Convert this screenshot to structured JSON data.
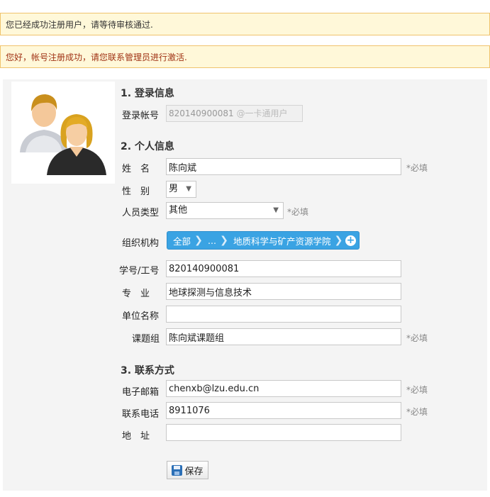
{
  "notices": {
    "pending_review": "您已经成功注册用户，请等待审核通过.",
    "activate": "您好，帐号注册成功，请您联系管理员进行激活."
  },
  "avatar": {
    "icon": "users-icon"
  },
  "section_login": {
    "title": "1. 登录信息",
    "account_label": "登录帐号",
    "account_value": "820140900081",
    "account_suffix": "@一卡通用户"
  },
  "section_personal": {
    "title": "2. 个人信息",
    "name_label": "姓　名",
    "name_value": "陈向斌",
    "gender_label": "性　别",
    "gender_value": "男",
    "type_label": "人员类型",
    "type_value": "其他",
    "org_label": "组织机构",
    "org_crumbs": [
      "全部",
      "...",
      "地质科学与矿产资源学院"
    ],
    "id_label": "学号/工号",
    "id_value": "820140900081",
    "major_label": "专　业",
    "major_value": "地球探测与信息技术",
    "unit_label": "单位名称",
    "unit_value": "",
    "group_label": "课题组",
    "group_value": "陈向斌课题组"
  },
  "section_contact": {
    "title": "3. 联系方式",
    "email_label": "电子邮箱",
    "email_value": "chenxb@lzu.edu.cn",
    "phone_label": "联系电话",
    "phone_value": "8911076",
    "address_label": "地　址",
    "address_value": ""
  },
  "required_text": "*必填",
  "save_label": "保存",
  "colors": {
    "notice_bg": "#fff8d9",
    "notice_border": "#f0c36d",
    "notice2_text": "#a03214",
    "breadcrumb": "#3aa3e3"
  }
}
